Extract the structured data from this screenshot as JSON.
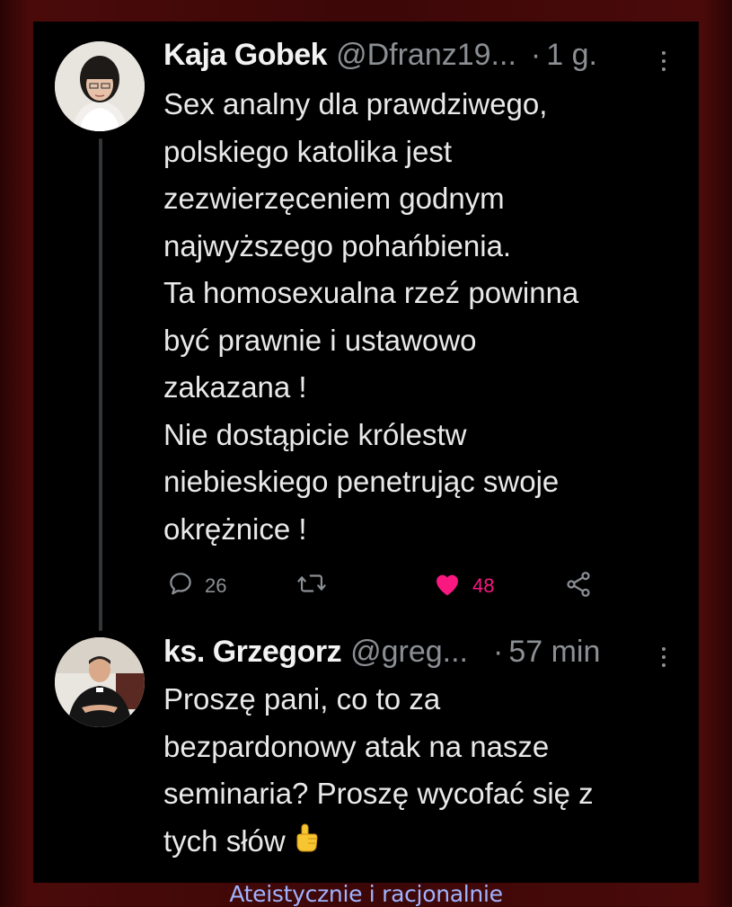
{
  "tweet1": {
    "name": "Kaja Gobek",
    "handle": "@Dfranz19...",
    "dot": "·",
    "time": "1 g.",
    "text": "Sex analny dla prawdziwego,\npolskiego katolika jest\nzezwierzęceniem godnym\nnajwyższego pohańbienia.\nTa homosexualna rzeź powinna\nbyć prawnie i ustawowo\nzakazana !\nNie dostąpicie królestw\nniebieskiego penetrując swoje\nokrężnice !",
    "reply_count": "26",
    "retweet_count": "",
    "like_count": "48",
    "icons": {
      "reply": "reply-icon",
      "retweet": "retweet-icon",
      "like": "heart-icon",
      "share": "share-icon",
      "more": "more-icon"
    },
    "like_color": "#f91880"
  },
  "tweet2": {
    "name": "ks. Grzegorz",
    "handle": "@greg...",
    "dot": "·",
    "time": "57 min",
    "text": "Proszę pani, co to za\nbezpardonowy atak na nasze\nseminaria? Proszę wycofać się z\ntych słów",
    "emoji": "pointing-up-emoji"
  },
  "watermark": "Ateistycznie i racjonalnie",
  "colors": {
    "background": "#000000",
    "frame": "#3d0707",
    "text": "#e9e9ea",
    "muted": "#8b8f94",
    "watermark": "#9fb3ff"
  }
}
